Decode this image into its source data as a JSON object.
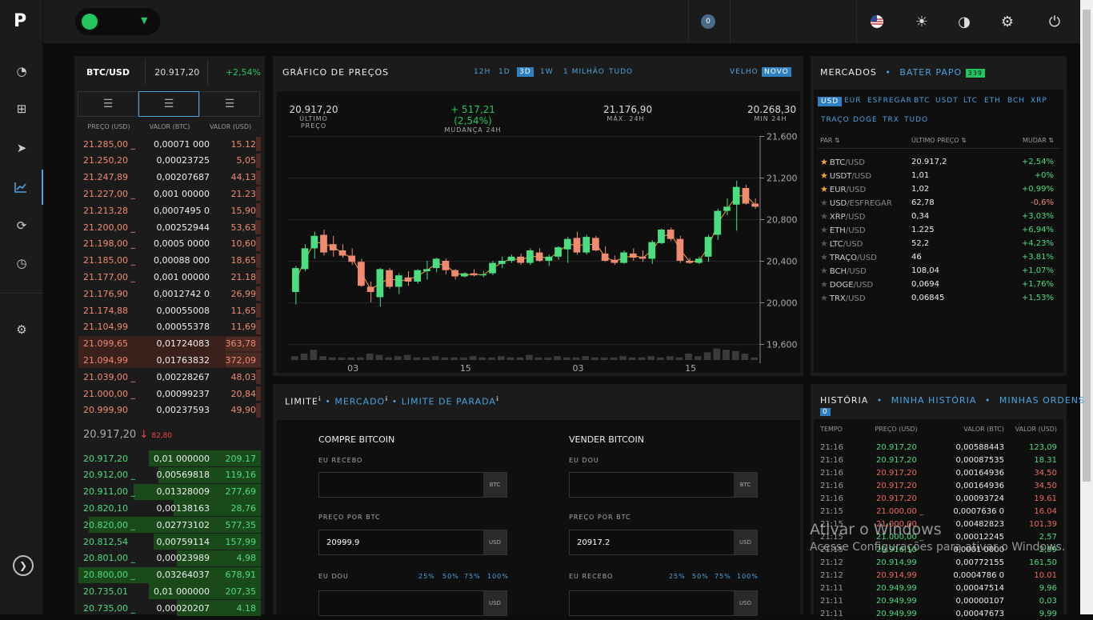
{
  "app": {
    "logo": "P"
  },
  "topbar": {
    "notification_count": "0"
  },
  "ticker": {
    "pair": "BTC/USD",
    "price": "20.917,20",
    "change": "+2,54%"
  },
  "orderbook": {
    "col_price": "PREÇO (USD)",
    "col_amount": "VALOR (BTC)",
    "col_total": "VALOR (USD)",
    "asks": [
      {
        "p": "21.285,00 _",
        "v": "0,00071 000",
        "t": "15.12",
        "depth": 0.04
      },
      {
        "p": "21.250,20",
        "v": "0,00023725",
        "t": "5,05",
        "depth": 0.02
      },
      {
        "p": "21.247,89",
        "v": "0,00207687",
        "t": "44,13",
        "depth": 0.12
      },
      {
        "p": "21.227,00 _",
        "v": "0,001 00000",
        "t": "21.23",
        "depth": 0.06
      },
      {
        "p": "21.213,28",
        "v": "0,0007495 0",
        "t": "15,90",
        "depth": 0.04
      },
      {
        "p": "21.200,00 _",
        "v": "0,00252944",
        "t": "53,63",
        "depth": 0.15
      },
      {
        "p": "21.198,00 _",
        "v": "0,0005 0000",
        "t": "10,60",
        "depth": 0.03
      },
      {
        "p": "21.185,00 _",
        "v": "0,00088 000",
        "t": "18,65",
        "depth": 0.05
      },
      {
        "p": "21.177,00 _",
        "v": "0,001 00000",
        "t": "21.18",
        "depth": 0.06
      },
      {
        "p": "21.176,90",
        "v": "0,0012742 0",
        "t": "26,99",
        "depth": 0.07
      },
      {
        "p": "21.174,88",
        "v": "0,00055008",
        "t": "11,65",
        "depth": 0.03
      },
      {
        "p": "21.104,99",
        "v": "0,00055378",
        "t": "11,69",
        "depth": 0.03
      },
      {
        "p": "21.099,65",
        "v": "0,01724083",
        "t": "363,78",
        "depth": 1.0
      },
      {
        "p": "21.094,99",
        "v": "0,01763832",
        "t": "372,09",
        "depth": 1.0
      },
      {
        "p": "21.039,00 _",
        "v": "0,00228267",
        "t": "48,03",
        "depth": 0.13
      },
      {
        "p": "21.000,00 _",
        "v": "0,00099237",
        "t": "20,84",
        "depth": 0.06
      },
      {
        "p": "20.999,90",
        "v": "0,00237593",
        "t": "49,90",
        "depth": 0.14
      }
    ],
    "mid": {
      "price": "20.917,20",
      "arrow": "↓",
      "delta": "82,80"
    },
    "bids": [
      {
        "p": "20.917,20",
        "v": "0,01 000000",
        "t": "209.17",
        "depth": 0.3
      },
      {
        "p": "20.912,00 _",
        "v": "0,00569818",
        "t": "119,16",
        "depth": 0.2
      },
      {
        "p": "20.911,00 _",
        "v": "0,01328009",
        "t": "277,69",
        "depth": 0.45
      },
      {
        "p": "20.820,10",
        "v": "0,00138163",
        "t": "28,76",
        "depth": 0.05
      },
      {
        "p": "20.820,00 _",
        "v": "0,02773102",
        "t": "577,35",
        "depth": 0.9
      },
      {
        "p": "20.812,54",
        "v": "0,00759114",
        "t": "157,99",
        "depth": 0.25
      },
      {
        "p": "20.801,00 _",
        "v": "0,00023989",
        "t": "4,98",
        "depth": 0.02
      },
      {
        "p": "20.800,00 _",
        "v": "0,03264037",
        "t": "678,91",
        "depth": 1.0
      },
      {
        "p": "20.735,01",
        "v": "0,01 000000",
        "t": "207,35",
        "depth": 0.3
      },
      {
        "p": "20.735,00 _",
        "v": "0,00020207",
        "t": "4.18",
        "depth": 0.02
      }
    ]
  },
  "chart_panel": {
    "title": "GRÁFICO DE PREÇOS",
    "timeframes": [
      "12H",
      "1D",
      "3D",
      "1W",
      "1 MILHÃO",
      "TUDO"
    ],
    "selected_timeframe": "3D",
    "style_old": "VELHO",
    "style_new": "NOVO",
    "stats": [
      {
        "value": "20.917,20",
        "label": "ÚLTIMO PREÇO",
        "color": "#dddddd"
      },
      {
        "value": "+ 517,21 (2,54%)",
        "label": "MUDANÇA 24H",
        "color": "#22c55e"
      },
      {
        "value": "21.176,90",
        "label": "MÁX. 24H",
        "color": "#dddddd"
      },
      {
        "value": "20.268,30",
        "label": "MIN 24H",
        "color": "#dddddd"
      }
    ]
  },
  "chart_data": {
    "type": "candlestick",
    "y_ticks": [
      "21,600",
      "21,200",
      "20,800",
      "20,400",
      "20,000",
      "19,600"
    ],
    "ylim": [
      19600,
      21600
    ],
    "x_ticks": [
      {
        "label": "03",
        "i": 6
      },
      {
        "label": "15",
        "i": 18
      },
      {
        "label": "03",
        "i": 30
      },
      {
        "label": "15",
        "i": 42
      }
    ],
    "candles": [
      [
        20100,
        19980,
        20350,
        20330
      ],
      [
        20320,
        20300,
        20560,
        20520
      ],
      [
        20520,
        20420,
        20680,
        20640
      ],
      [
        20650,
        20450,
        20700,
        20480
      ],
      [
        20560,
        20440,
        20640,
        20500
      ],
      [
        20500,
        20430,
        20560,
        20450
      ],
      [
        20450,
        20360,
        20520,
        20390
      ],
      [
        20390,
        20150,
        20420,
        20160
      ],
      [
        20150,
        20000,
        20200,
        20100
      ],
      [
        20050,
        19960,
        20330,
        20320
      ],
      [
        20310,
        20130,
        20330,
        20150
      ],
      [
        20150,
        20080,
        20280,
        20260
      ],
      [
        20240,
        20160,
        20300,
        20200
      ],
      [
        20200,
        20180,
        20320,
        20310
      ],
      [
        20300,
        20220,
        20400,
        20320
      ],
      [
        20330,
        20290,
        20430,
        20420
      ],
      [
        20400,
        20270,
        20420,
        20310
      ],
      [
        20310,
        20220,
        20320,
        20250
      ],
      [
        20250,
        20240,
        20290,
        20280
      ],
      [
        20280,
        20250,
        20320,
        20260
      ],
      [
        20260,
        20240,
        20300,
        20270
      ],
      [
        20280,
        20260,
        20400,
        20380
      ],
      [
        20370,
        20330,
        20440,
        20400
      ],
      [
        20400,
        20380,
        20460,
        20440
      ],
      [
        20440,
        20360,
        20470,
        20380
      ],
      [
        20380,
        20360,
        20520,
        20500
      ],
      [
        20480,
        20390,
        20520,
        20400
      ],
      [
        20400,
        20350,
        20460,
        20440
      ],
      [
        20440,
        20410,
        20540,
        20530
      ],
      [
        20510,
        20380,
        20630,
        20610
      ],
      [
        20620,
        20460,
        20680,
        20480
      ],
      [
        20480,
        20460,
        20650,
        20630
      ],
      [
        20620,
        20490,
        20640,
        20500
      ],
      [
        20470,
        20390,
        20540,
        20400
      ],
      [
        20410,
        20360,
        20450,
        20380
      ],
      [
        20380,
        20370,
        20500,
        20480
      ],
      [
        20470,
        20400,
        20520,
        20430
      ],
      [
        20440,
        20390,
        20500,
        20420
      ],
      [
        20420,
        20370,
        20600,
        20580
      ],
      [
        20570,
        20560,
        20710,
        20700
      ],
      [
        20700,
        20590,
        20720,
        20610
      ],
      [
        20610,
        20380,
        20640,
        20400
      ],
      [
        20400,
        20370,
        20430,
        20380
      ],
      [
        20380,
        20370,
        20440,
        20420
      ],
      [
        20440,
        20390,
        20650,
        20630
      ],
      [
        20650,
        20600,
        20900,
        20880
      ],
      [
        20880,
        20840,
        21000,
        20920
      ],
      [
        20940,
        20690,
        21170,
        21110
      ],
      [
        21100,
        20940,
        21130,
        20950
      ],
      [
        20950,
        20900,
        21000,
        20920
      ]
    ],
    "volumes": [
      3,
      5,
      8,
      3,
      2,
      2,
      2,
      2,
      5,
      4,
      2,
      3,
      4,
      2,
      2,
      3,
      2,
      2,
      2,
      3,
      2,
      2,
      3,
      2,
      2,
      4,
      2,
      2,
      3,
      2,
      2,
      3,
      2,
      2,
      2,
      3,
      2,
      2,
      3,
      2,
      3,
      2,
      5,
      3,
      6,
      9,
      8,
      7,
      5,
      2
    ],
    "up_color": "#4ade80",
    "down_color": "#f08a70",
    "ma_color": "#f5a623"
  },
  "markets": {
    "title": "MERCADOS",
    "chat_label": "BATER PAPO",
    "chat_count": "339",
    "tabs_row1": [
      "USD",
      "EUR",
      "ESFREGAR",
      "BTC",
      "USDT",
      "LTC",
      "ETH",
      "BCH",
      "XRP"
    ],
    "tabs_row2": [
      "TRAÇO",
      "DOGE",
      "TRX",
      "TUDO"
    ],
    "selected_tab": "USD",
    "col_pair": "PAR",
    "col_last": "ÚLTIMO PREÇO",
    "col_change": "MUDAR",
    "rows": [
      {
        "base": "BTC",
        "quote": "/USD",
        "last": "20.917,2",
        "change": "+2,54%",
        "fav": true,
        "dir": "up"
      },
      {
        "base": "USDT",
        "quote": "/USD",
        "last": "1,01",
        "change": "+0%",
        "fav": true,
        "dir": "up"
      },
      {
        "base": "EUR",
        "quote": "/USD",
        "last": "1,02",
        "change": "+0,99%",
        "fav": true,
        "dir": "up"
      },
      {
        "base": "USD",
        "quote": "/ESFREGAR",
        "last": "62,78",
        "change": "-0,6%",
        "fav": false,
        "dir": "down"
      },
      {
        "base": "XRP",
        "quote": "/USD",
        "last": "0,34",
        "change": "+3,03%",
        "fav": false,
        "dir": "up"
      },
      {
        "base": "ETH",
        "quote": "/USD",
        "last": "1.225",
        "change": "+6,94%",
        "fav": false,
        "dir": "up"
      },
      {
        "base": "LTC",
        "quote": "/USD",
        "last": "52,2",
        "change": "+4,23%",
        "fav": false,
        "dir": "up"
      },
      {
        "base": "TRAÇO",
        "quote": "/USD",
        "last": "46",
        "change": "+3,81%",
        "fav": false,
        "dir": "up"
      },
      {
        "base": "BCH",
        "quote": "/USD",
        "last": "108,04",
        "change": "+1,07%",
        "fav": false,
        "dir": "up"
      },
      {
        "base": "DOGE",
        "quote": "/USD",
        "last": "0,0694",
        "change": "+1,76%",
        "fav": false,
        "dir": "up"
      },
      {
        "base": "TRX",
        "quote": "/USD",
        "last": "0,06845",
        "change": "+1,53%",
        "fav": false,
        "dir": "up"
      }
    ]
  },
  "order_form": {
    "tab_limit": "LIMITE",
    "tab_market": "MERCADO",
    "tab_stop": "LIMITE DE PARADA",
    "buy_title": "COMPRE BITCOIN",
    "sell_title": "VENDER BITCOIN",
    "buy_receive_label": "EU RECEBO",
    "sell_give_label": "EU DOU",
    "price_label": "PREÇO POR BTC",
    "buy_give_label": "EU DOU",
    "sell_receive_label": "EU RECEBO",
    "unit_btc": "BTC",
    "unit_usd": "USD",
    "buy_price": "20999.9",
    "sell_price": "20917.2",
    "percents": [
      "25%",
      "50%",
      "75%",
      "100%"
    ]
  },
  "history": {
    "title": "HISTÓRIA",
    "my_history": "MINHA HISTÓRIA",
    "my_orders": "MINHAS ORDENS",
    "orders_count": "0",
    "col_time": "TEMPO",
    "col_price": "PREÇO (USD)",
    "col_amount": "VALOR (BTC)",
    "col_total": "VALOR (USD)",
    "rows": [
      {
        "tm": "21:16",
        "pr": "20.917,20",
        "vl": "0,00588443",
        "tt": "123,09",
        "dir": "up"
      },
      {
        "tm": "21:16",
        "pr": "20.917,20",
        "vl": "0,00087535",
        "tt": "18.31",
        "dir": "up"
      },
      {
        "tm": "21:16",
        "pr": "20.917,20",
        "vl": "0,00164936",
        "tt": "34,50",
        "dir": "down"
      },
      {
        "tm": "21:16",
        "pr": "20.917,20",
        "vl": "0,00164936",
        "tt": "34,50",
        "dir": "down"
      },
      {
        "tm": "21:16",
        "pr": "20.917,20",
        "vl": "0,00093724",
        "tt": "19.61",
        "dir": "down"
      },
      {
        "tm": "21:15",
        "pr": "21.000,00 _",
        "vl": "0,0007636 0",
        "tt": "16.04",
        "dir": "down"
      },
      {
        "tm": "21:15",
        "pr": "21.000,00",
        "vl": "0,00482823",
        "tt": "101,39",
        "dir": "down"
      },
      {
        "tm": "21:15",
        "pr": "21.000,00 _",
        "vl": "0,00012245",
        "tt": "2,57",
        "dir": "up"
      },
      {
        "tm": "21:15",
        "pr": "20.916,10",
        "vl": "0,0001 0000",
        "tt": "2,09",
        "dir": "up"
      },
      {
        "tm": "21:12",
        "pr": "20.914,99",
        "vl": "0,00772155",
        "tt": "161,50",
        "dir": "up"
      },
      {
        "tm": "21:12",
        "pr": "20.914,99",
        "vl": "0,0004786 0",
        "tt": "10.01",
        "dir": "down"
      },
      {
        "tm": "21:11",
        "pr": "20.949,99",
        "vl": "0,00047514",
        "tt": "9,96",
        "dir": "up"
      },
      {
        "tm": "21:11",
        "pr": "20.949,99",
        "vl": "0,00000107",
        "tt": "0,03",
        "dir": "up"
      },
      {
        "tm": "21:11",
        "pr": "20.949,99",
        "vl": "0,00047673",
        "tt": "9,99",
        "dir": "up"
      }
    ]
  },
  "watermark": {
    "line1": "Ativar o Windows",
    "line2": "Acesse Configurações para ativar o Windows."
  },
  "colors": {
    "up": "#4ade80",
    "down": "#f08a70",
    "accent": "#4aa3df",
    "brand_green": "#22c55e"
  }
}
